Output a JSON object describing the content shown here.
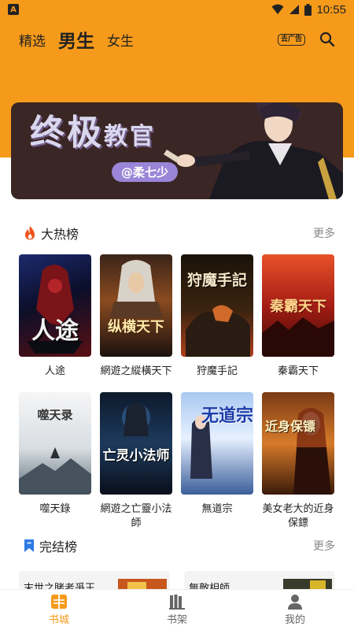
{
  "status_bar": {
    "time": "10:55",
    "app_badge": "A"
  },
  "nav": {
    "tabs": [
      {
        "label": "精选",
        "active": false
      },
      {
        "label": "男生",
        "active": true
      },
      {
        "label": "女生",
        "active": false
      }
    ],
    "ad_button": "去广告",
    "search_icon": "search-icon"
  },
  "banner": {
    "title_main": "终极",
    "title_sub": "教官",
    "author": "@柔七少"
  },
  "hot": {
    "title": "大热榜",
    "more": "更多",
    "books": [
      {
        "title": "人途",
        "cover_text": "人途"
      },
      {
        "title": "網遊之縱橫天下",
        "cover_text": "纵横天下"
      },
      {
        "title": "狩魔手記",
        "cover_text": "狩魔手記"
      },
      {
        "title": "秦霸天下",
        "cover_text": "秦霸天下"
      },
      {
        "title": "噬天錄",
        "cover_text": "噬天录"
      },
      {
        "title": "網遊之亡靈小法師",
        "cover_text": "亡灵小法师"
      },
      {
        "title": "無道宗",
        "cover_text": "无道宗"
      },
      {
        "title": "美女老大的近身保鏢",
        "cover_text": "近身保镖"
      }
    ]
  },
  "complete": {
    "title": "完结榜",
    "more": "更多",
    "previews": [
      {
        "title": "末世之賭者爭王"
      },
      {
        "title": "無敵相師"
      }
    ]
  },
  "bottom_nav": {
    "items": [
      {
        "label": "书城",
        "active": true
      },
      {
        "label": "书架",
        "active": false
      },
      {
        "label": "我的",
        "active": false
      }
    ]
  },
  "colors": {
    "accent": "#f59a1b",
    "hot_icon": "#f0541e",
    "bookmark_icon": "#2f7be6"
  }
}
